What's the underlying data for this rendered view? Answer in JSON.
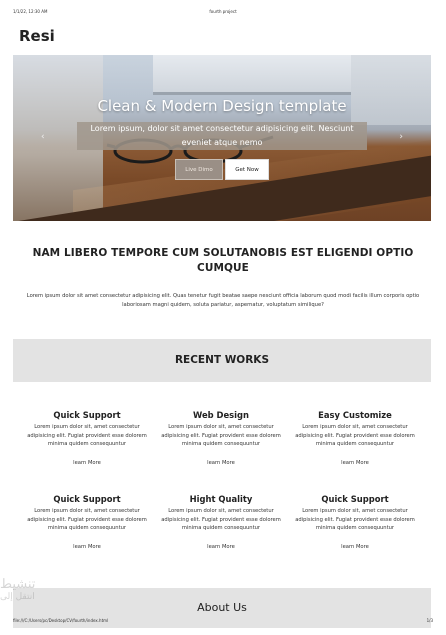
{
  "print_header": {
    "date": "1/1/22, 12:30 AM",
    "title": "fourth project"
  },
  "brand": {
    "logo": "Resi"
  },
  "hero": {
    "title": "Clean & Modern Design template",
    "subtitle": "Lorem ipsum, dolor sit amet consectetur adipisicing elit. Nesciunt eveniet atque nemo",
    "live_demo_label": "Live Dimo",
    "get_now_label": "Get Now",
    "prev_icon": "chevron-left-icon",
    "next_icon": "chevron-right-icon"
  },
  "headline": "NAM LIBERO TEMPORE CUM SOLUTANOBIS EST ELIGENDI OPTIO CUMQUE",
  "intro": "Lorem ipsum dolor sit amet consectetur adipisicing elit. Quas tenetur fugit beatae saepe nesciunt officia laborum quod modi facilis illum corporis optio laboriosam magni quidem, soluta pariatur, aspernatur, voluptatum similique?",
  "recent_works": {
    "heading": "RECENT WORKS",
    "items": [
      {
        "title": "Quick Support",
        "text": "Lorem ipsum dolor sit, amet consectetur adipisicing elit. Fugiat provident esse dolorem minima quidem consequuntur",
        "more": "learn More"
      },
      {
        "title": "Web Design",
        "text": "Lorem ipsum dolor sit, amet consectetur adipisicing elit. Fugiat provident esse dolorem minima quidem consequuntur",
        "more": "learn More"
      },
      {
        "title": "Easy Customize",
        "text": "Lorem ipsum dolor sit, amet consectetur adipisicing elit. Fugiat provident esse dolorem minima quidem consequuntur",
        "more": "learn More"
      },
      {
        "title": "Quick Support",
        "text": "Lorem ipsum dolor sit, amet consectetur adipisicing elit. Fugiat provident esse dolorem minima quidem consequuntur",
        "more": "learn More"
      },
      {
        "title": "Hight Quality",
        "text": "Lorem ipsum dolor sit, amet consectetur adipisicing elit. Fugiat provident esse dolorem minima quidem consequuntur",
        "more": "learn More"
      },
      {
        "title": "Quick Support",
        "text": "Lorem ipsum dolor sit, amet consectetur adipisicing elit. Fugiat provident esse dolorem minima quidem consequuntur",
        "more": "learn More"
      }
    ]
  },
  "about": {
    "heading": "About Us"
  },
  "watermark": {
    "line1": "تنشيط",
    "line2": "انتقل إلى"
  },
  "print_footer": {
    "path": "file:///C:/Users/pc/Desktop/CV/fourth/index.html",
    "page": "1/3"
  }
}
